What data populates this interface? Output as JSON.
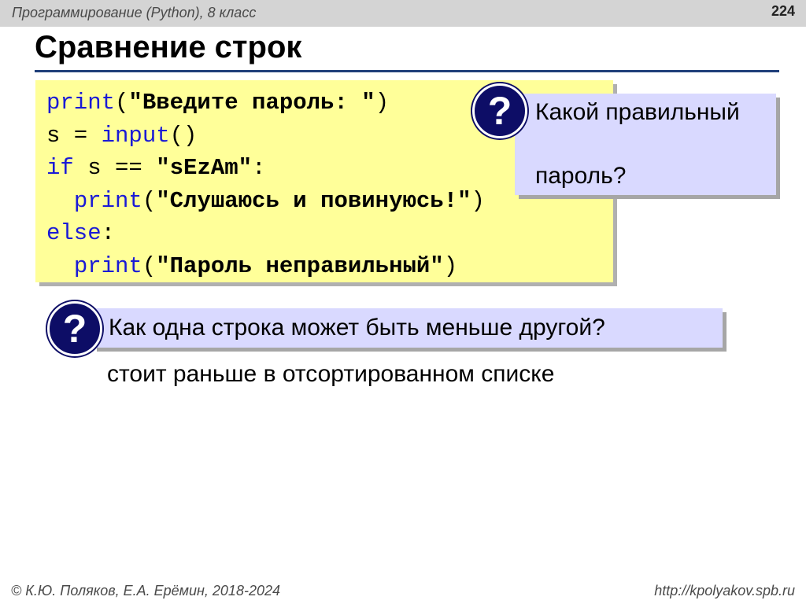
{
  "header": {
    "course": "Программирование (Python), 8 класс",
    "page_number": "224"
  },
  "title": "Сравнение строк",
  "code": {
    "line1": {
      "kw": "print",
      "p1": "(",
      "str": "\"Введите пароль: \"",
      "p2": ")"
    },
    "line2": {
      "a": "s = ",
      "kw": "input",
      "b": "()"
    },
    "line3": {
      "kw": "if",
      "a": " s == ",
      "str": "\"sEzAm\"",
      "b": ":"
    },
    "line4": {
      "indent": "  ",
      "kw": "print",
      "p1": "(",
      "str": "\"Слушаюсь и повинуюсь!\"",
      "p2": ")"
    },
    "line5": {
      "kw": "else",
      "b": ":"
    },
    "line6": {
      "indent": "  ",
      "kw": "print",
      "p1": "(",
      "str": "\"Пароль неправильный\"",
      "p2": ")"
    }
  },
  "question1": {
    "icon": "?",
    "line1": "Какой правильный",
    "line2": "пароль?"
  },
  "question2": {
    "icon": "?",
    "text": "Как одна строка может быть меньше другой?"
  },
  "answer": "стоит раньше в отсортированном списке",
  "footer": {
    "left": "© К.Ю. Поляков, Е.А. Ерёмин, 2018-2024",
    "right": "http://kpolyakov.spb.ru"
  },
  "colors": {
    "code_background": "#ffff99",
    "question_background": "#d9d9ff",
    "question_icon": "#0d0d66",
    "keyword": "#1a1ad6",
    "title_rule": "#1f3f7a"
  }
}
